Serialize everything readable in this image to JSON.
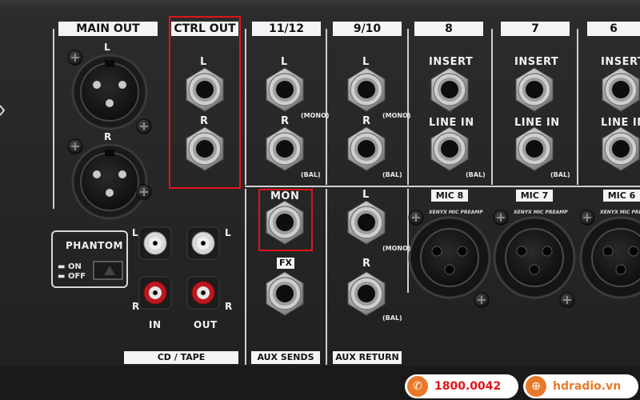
{
  "sections": {
    "main_out": "MAIN OUT",
    "ctrl_out": "CTRL OUT",
    "ch_11_12": "11/12",
    "ch_9_10": "9/10",
    "ch_8": "8",
    "ch_7": "7",
    "ch_6": "6"
  },
  "jack_labels": {
    "left": "L",
    "right": "R",
    "mono": "(MONO)",
    "bal": "(BAL)",
    "insert": "INSERT",
    "line_in": "LINE IN",
    "mon": "MON",
    "fx": "FX",
    "in": "IN",
    "out": "OUT"
  },
  "mic_labels": [
    "MIC 8",
    "MIC 7",
    "MIC 6"
  ],
  "mic_preamp_logo": "XENYX MIC PREAMP",
  "phantom": {
    "title": "PHANTOM",
    "on": "ON",
    "off": "OFF"
  },
  "footer_labels": {
    "cd_tape": "CD / TAPE",
    "aux_sends": "AUX SENDS",
    "aux_return": "AUX RETURN"
  },
  "contact": {
    "phone": "1800.0042",
    "website": "hdradio.vn"
  },
  "colors": {
    "highlight": "#e0141b",
    "accent": "#e8792b",
    "panel": "#262626"
  }
}
